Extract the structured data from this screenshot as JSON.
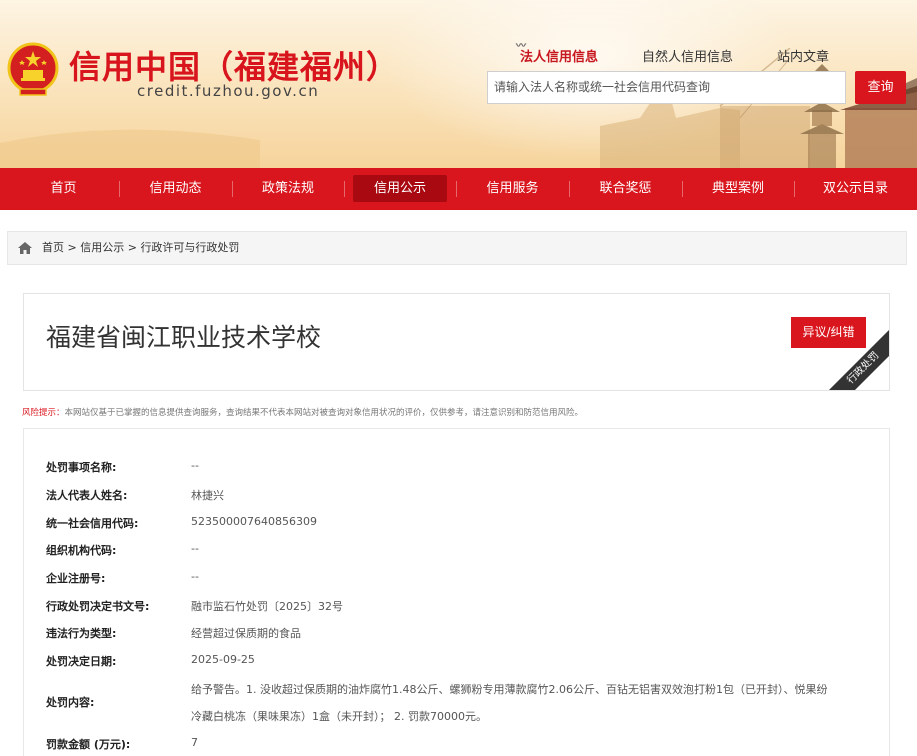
{
  "header": {
    "site_title": "信用中国（福建福州）",
    "site_domain": "credit.fuzhou.gov.cn",
    "search_tabs": [
      {
        "label": "法人信用信息",
        "active": true
      },
      {
        "label": "自然人信用信息",
        "active": false
      },
      {
        "label": "站内文章",
        "active": false
      }
    ],
    "search_placeholder": "请输入法人名称或统一社会信用代码查询",
    "search_button": "查询"
  },
  "nav": {
    "items": [
      {
        "label": "首页",
        "active": false
      },
      {
        "label": "信用动态",
        "active": false
      },
      {
        "label": "政策法规",
        "active": false
      },
      {
        "label": "信用公示",
        "active": true
      },
      {
        "label": "信用服务",
        "active": false
      },
      {
        "label": "联合奖惩",
        "active": false
      },
      {
        "label": "典型案例",
        "active": false
      },
      {
        "label": "双公示目录",
        "active": false
      }
    ]
  },
  "breadcrumb": {
    "items": [
      "首页",
      "信用公示",
      "行政许可与行政处罚"
    ],
    "separator": ">"
  },
  "entity": {
    "name": "福建省闽江职业技术学校",
    "objection_button": "异议/纠错",
    "ribbon_label": "行政处罚"
  },
  "risk_notice": {
    "label": "风险提示：",
    "text": "本网站仅基于已掌握的信息提供查询服务，查询结果不代表本网站对被查询对象信用状况的评价，仅供参考，请注意识别和防范信用风险。"
  },
  "details": [
    {
      "key": "处罚事项名称:",
      "value": "--"
    },
    {
      "key": "法人代表人姓名:",
      "value": "林捷兴"
    },
    {
      "key": "统一社会信用代码:",
      "value": "523500007640856309"
    },
    {
      "key": "组织机构代码:",
      "value": "--"
    },
    {
      "key": "企业注册号:",
      "value": "--"
    },
    {
      "key": "行政处罚决定书文号:",
      "value": "融市监石竹处罚〔2025〕32号"
    },
    {
      "key": "违法行为类型:",
      "value": "经营超过保质期的食品"
    },
    {
      "key": "处罚决定日期:",
      "value": "2025-09-25"
    },
    {
      "key": "处罚内容:",
      "value_lines": [
        "给予警告。1. 没收超过保质期的油炸腐竹1.48公斤、螺狮粉专用薄款腐竹2.06公斤、百钻无铝害双效泡打粉1包（已开封）、悦果纷",
        "冷藏白桃冻（果味果冻）1盒（未开封）； 2. 罚款70000元。"
      ]
    },
    {
      "key": "罚款金额 (万元):",
      "value": "7"
    }
  ],
  "colors": {
    "brand_red": "#d9161e",
    "nav_active": "#a90a12"
  }
}
